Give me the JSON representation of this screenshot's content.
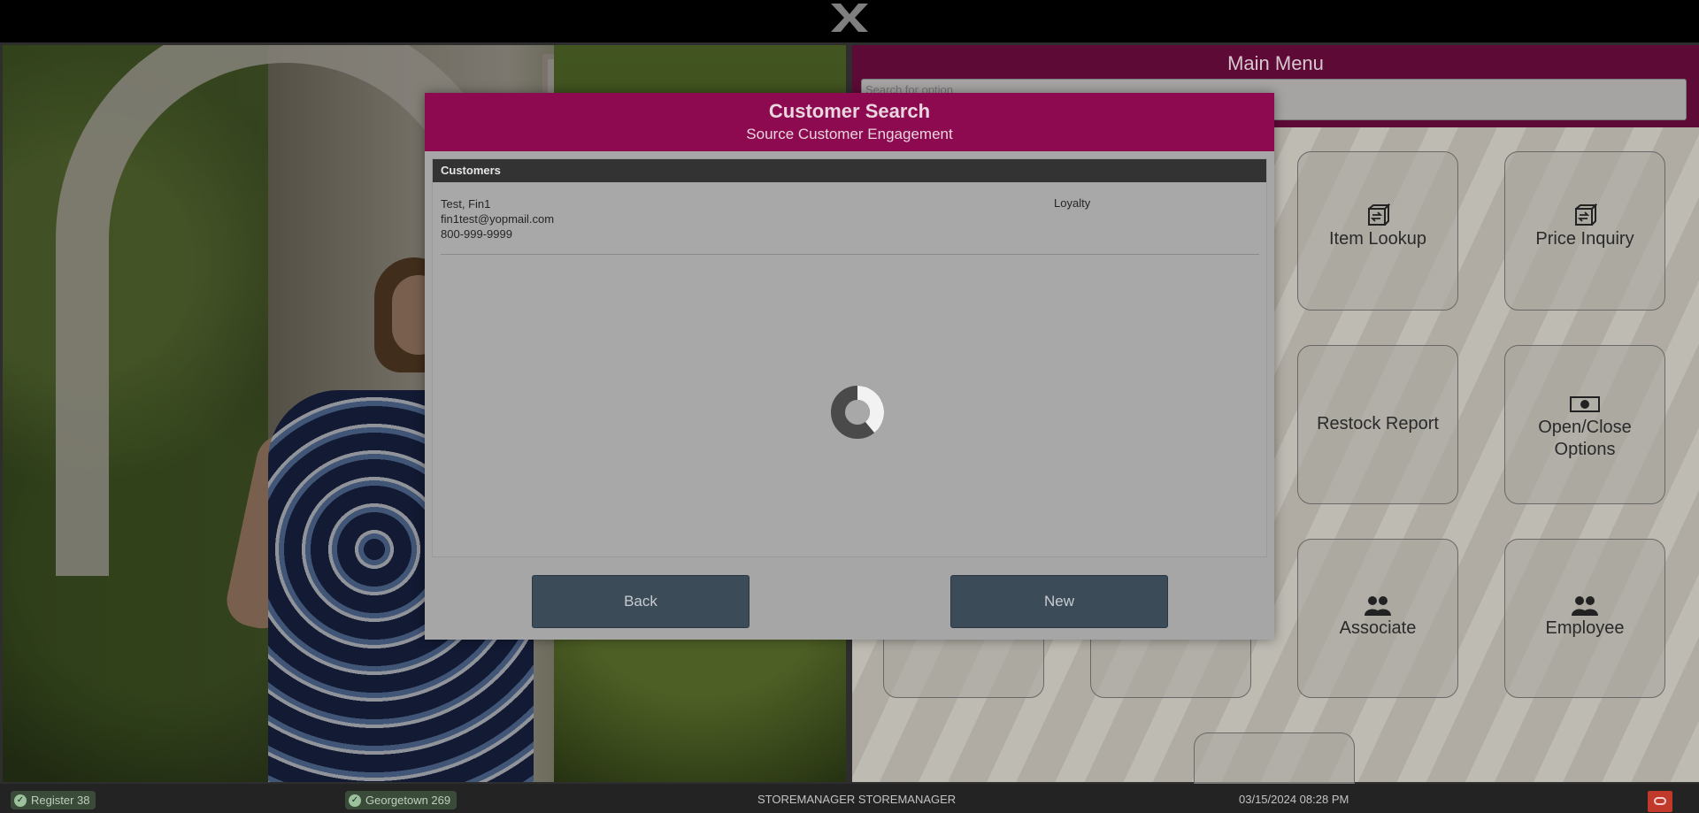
{
  "app": {
    "logo": "x-logo"
  },
  "main_menu": {
    "title": "Main Menu",
    "search_placeholder": "Search for option",
    "tiles": [
      {
        "label": "Item Lookup",
        "icon": "box-arrows-icon"
      },
      {
        "label": "Price Inquiry",
        "icon": "box-arrows-icon"
      },
      {
        "label": "Restock Report",
        "icon": ""
      },
      {
        "label": "Open/Close Options",
        "icon": "cash-icon"
      },
      {
        "label": "Associate",
        "icon": "people-icon"
      },
      {
        "label": "Employee",
        "icon": "people-icon"
      }
    ]
  },
  "modal": {
    "title": "Customer Search",
    "subtitle": "Source Customer Engagement",
    "list_header": "Customers",
    "customers": [
      {
        "name": "Test, Fin1",
        "email": "fin1test@yopmail.com",
        "phone": "800-999-9999",
        "tag": "Loyalty"
      }
    ],
    "back_label": "Back",
    "new_label": "New"
  },
  "status_bar": {
    "register": "Register 38",
    "store": "Georgetown 269",
    "user": "STOREMANAGER STOREMANAGER",
    "datetime": "03/15/2024 08:28 PM"
  },
  "colors": {
    "modal_header": "#8d0a50",
    "menu_header": "#5e0a36",
    "button": "#3c4b58",
    "status_ok": "#9bc29b",
    "oracle": "#c0392b"
  }
}
